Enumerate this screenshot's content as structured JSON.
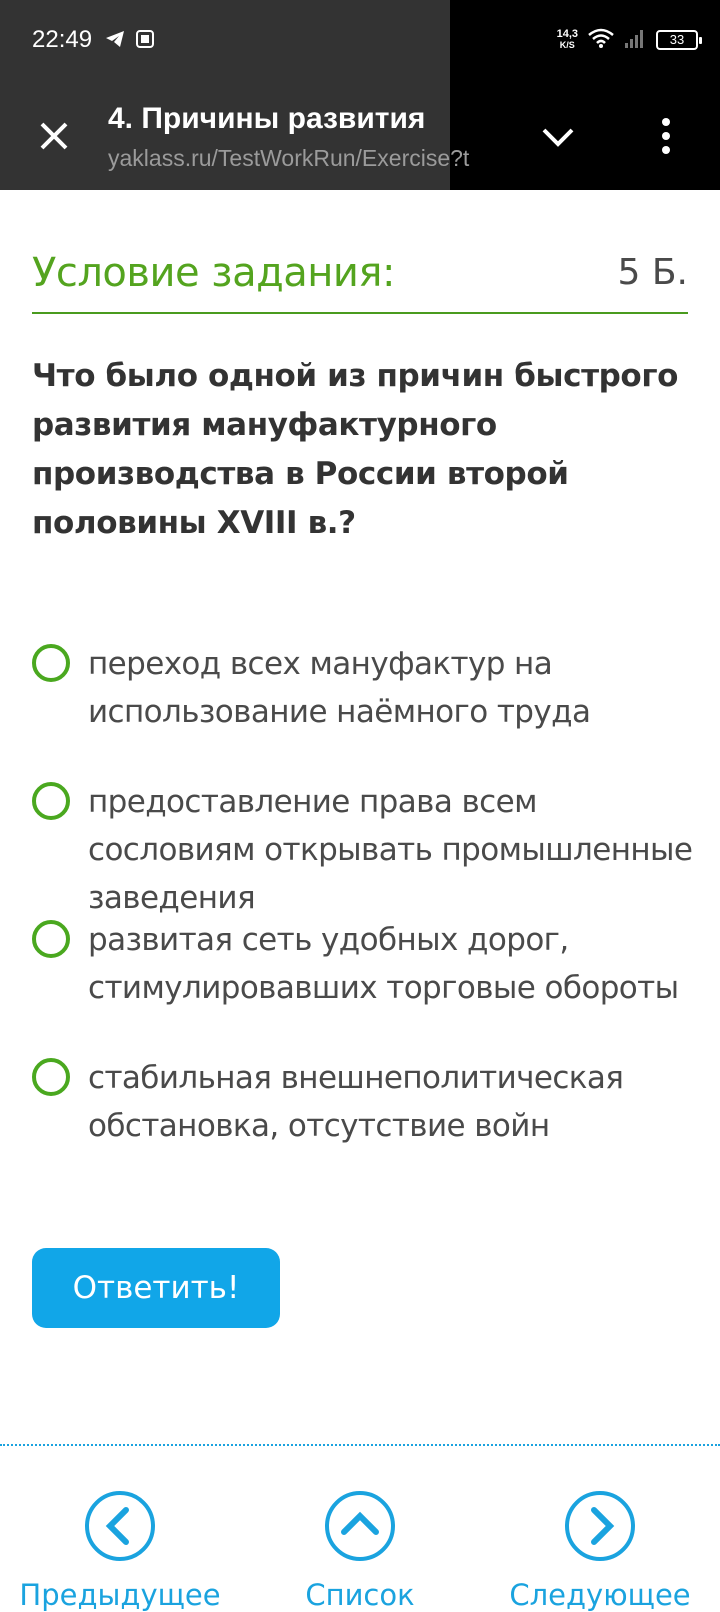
{
  "status_bar": {
    "time": "22:49",
    "net_speed_value": "14,3",
    "net_speed_unit": "K/S",
    "battery": "33"
  },
  "browser_bar": {
    "title": "4. Причины развития",
    "url": "yaklass.ru/TestWorkRun/Exercise?t"
  },
  "task": {
    "heading": "Условие задания:",
    "points": "5 Б.",
    "question": "Что было одной из причин быстрого развития мануфактурного производства в России второй половины XVIII в.?",
    "options": [
      "переход всех мануфактур на использование наёмного труда",
      "предоставление права всем сословиям открывать промышленные заведения",
      "развитая сеть удобных дорог, стимулировавших торговые обороты",
      "стабильная внешнеполитическая обстановка, отсутствие войн"
    ],
    "answer_button": "Ответить!"
  },
  "bottom_nav": {
    "prev": "Предыдущее",
    "list": "Список",
    "next": "Следующее"
  },
  "colors": {
    "green_accent": "#54a41f",
    "blue_accent": "#1aa3df",
    "answer_button": "#11a6e8"
  }
}
